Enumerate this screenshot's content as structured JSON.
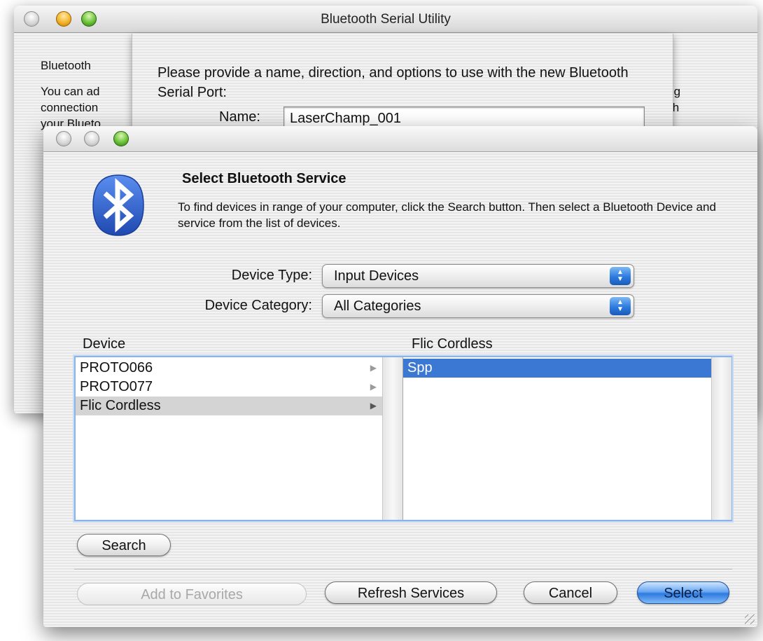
{
  "back_window": {
    "title": "Bluetooth Serial Utility",
    "heading_partial": "Bluetooth",
    "desc_partial": [
      "You can ad",
      "connection",
      "your Blueto"
    ],
    "right_partial": [
      "oing",
      "with"
    ]
  },
  "name_sheet": {
    "prompt": "Please provide a name, direction, and options to use with the new Bluetooth Serial Port:",
    "name_label": "Name:",
    "name_value": "LaserChamp_001"
  },
  "dialog": {
    "title": "Select Bluetooth Service",
    "description": "To find devices in range of your computer, click the Search button. Then select a Bluetooth Device and service from the list of devices.",
    "device_type_label": "Device Type:",
    "device_type_value": "Input Devices",
    "device_category_label": "Device Category:",
    "device_category_value": "All Categories",
    "device_column_header": "Device",
    "service_column_header": "Flic Cordless",
    "devices": [
      {
        "name": "PROTO066",
        "selected": false
      },
      {
        "name": "PROTO077",
        "selected": false
      },
      {
        "name": "Flic Cordless",
        "selected": true
      }
    ],
    "services": [
      {
        "name": "Spp",
        "selected": true
      }
    ],
    "buttons": {
      "search": "Search",
      "add_to_favorites": "Add to Favorites",
      "refresh_services": "Refresh Services",
      "cancel": "Cancel",
      "select": "Select"
    }
  },
  "colors": {
    "selection_blue": "#3b78d4",
    "bluetooth_blue": "#2d5fc4",
    "default_button": "#2e7ae0"
  }
}
